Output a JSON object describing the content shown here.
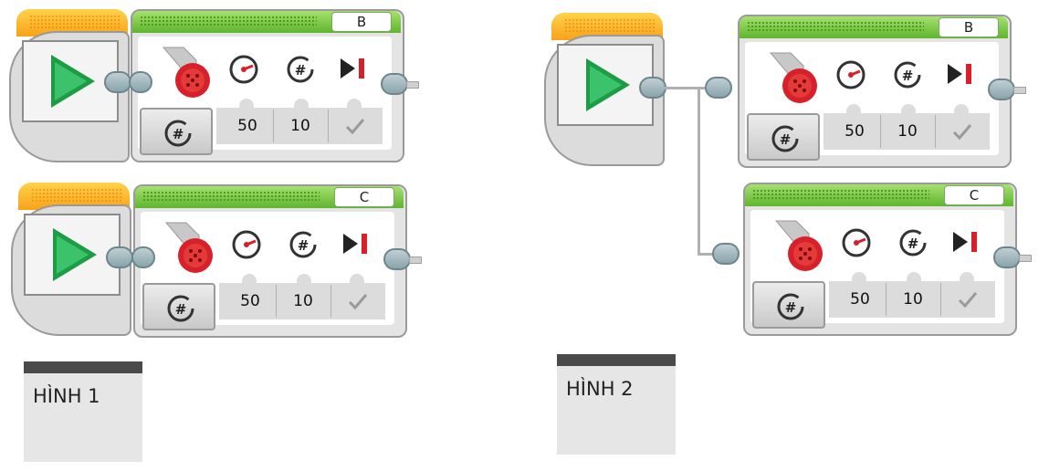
{
  "figures": [
    {
      "label": "HÌNH 1",
      "blocks": [
        {
          "port": "B",
          "power": "50",
          "rotations": "10",
          "brake_icon": "check-icon"
        },
        {
          "port": "C",
          "power": "50",
          "rotations": "10",
          "brake_icon": "check-icon"
        }
      ]
    },
    {
      "label": "HÌNH 2",
      "blocks": [
        {
          "port": "B",
          "power": "50",
          "rotations": "10",
          "brake_icon": "check-icon"
        },
        {
          "port": "C",
          "power": "50",
          "rotations": "10",
          "brake_icon": "check-icon"
        }
      ]
    }
  ],
  "colors": {
    "start_accent": "#f7a21a",
    "play": "#1d9c46",
    "motor_header": "#5fb52e",
    "motor_red": "#d8202a",
    "connector": "#8aa4ab",
    "label_bg": "#e6e6e6",
    "label_bar": "#4a4a4a"
  },
  "icons": [
    "play-icon",
    "motor-icon",
    "speed-gauge-icon",
    "rotations-icon",
    "brake-icon",
    "mode-rotations-icon",
    "check-icon"
  ]
}
